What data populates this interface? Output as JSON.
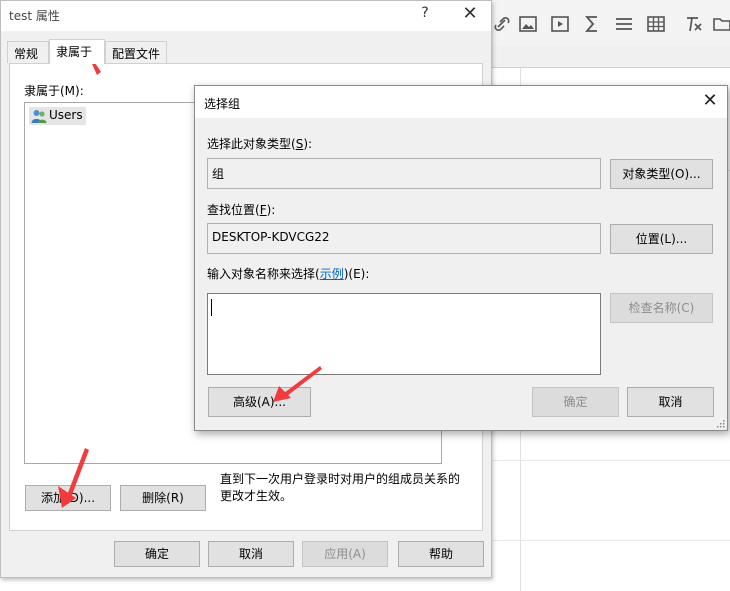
{
  "props_dialog": {
    "title": "test 属性",
    "help_glyph": "?",
    "close_glyph": "✕",
    "tabs": [
      {
        "label": "常规"
      },
      {
        "label": "隶属于"
      },
      {
        "label": "配置文件"
      }
    ],
    "member_of_label": "隶属于(M):",
    "members": [
      {
        "name": "Users"
      }
    ],
    "note": "直到下一次用户登录时对用户的组成员关系的更改才生效。",
    "add_button": "添加(D)...",
    "remove_button": "删除(R)",
    "ok_button": "确定",
    "cancel_button": "取消",
    "apply_button": "应用(A)",
    "help_button": "帮助"
  },
  "select_group_dialog": {
    "title": "选择组",
    "close_glyph": "✕",
    "object_type_label": "选择此对象类型(",
    "object_type_key": "S",
    "object_type_label_end": "):",
    "object_type_value": "组",
    "object_types_button": "对象类型(O)...",
    "location_label": "查找位置(",
    "location_key": "F",
    "location_label_end": "):",
    "location_value": "DESKTOP-KDVCG22",
    "location_button": "位置(L)...",
    "names_label": "输入对象名称来选择(",
    "names_link": "示例",
    "names_label_end": ")(E):",
    "names_value": "",
    "check_names_button": "检查名称(C)",
    "advanced_button": "高级(A)...",
    "ok_button": "确定",
    "cancel_button": "取消"
  },
  "background_toolbar": {
    "icons": [
      "link-icon",
      "image-icon",
      "video-icon",
      "sum-icon",
      "align-icon",
      "table-icon",
      "clear-format-icon",
      "folder-icon"
    ]
  },
  "colors": {
    "dialog_bg": "#f0f0f0",
    "annotation_arrow": "#f03c3c",
    "link": "#0066cc"
  }
}
